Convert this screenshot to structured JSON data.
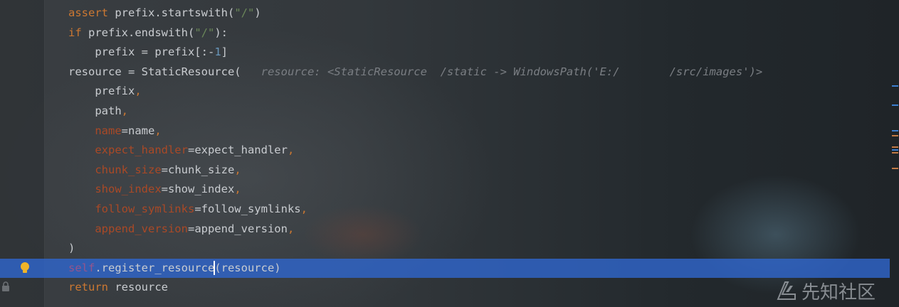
{
  "editor": {
    "lines": [
      [
        {
          "t": "assert ",
          "c": "kw"
        },
        {
          "t": "prefix.startswith(",
          "c": ""
        },
        {
          "t": "\"/\"",
          "c": "str"
        },
        {
          "t": ")",
          "c": ""
        }
      ],
      [
        {
          "t": "if ",
          "c": "kw"
        },
        {
          "t": "prefix.endswith(",
          "c": ""
        },
        {
          "t": "\"/\"",
          "c": "str"
        },
        {
          "t": "):",
          "c": ""
        }
      ],
      [
        {
          "t": "    prefix = prefix[:-",
          "c": ""
        },
        {
          "t": "1",
          "c": "num"
        },
        {
          "t": "]",
          "c": ""
        }
      ],
      [
        {
          "t": "resource = StaticResource(",
          "c": ""
        },
        {
          "t": "   resource: <StaticResource  /static -> WindowsPath('E:/",
          "c": "hint"
        },
        {
          "t": "",
          "c": "mask"
        },
        {
          "t": "/src/images')>",
          "c": "hint"
        }
      ],
      [
        {
          "t": "    prefix",
          "c": ""
        },
        {
          "t": ",",
          "c": "kw"
        }
      ],
      [
        {
          "t": "    path",
          "c": ""
        },
        {
          "t": ",",
          "c": "kw"
        }
      ],
      [
        {
          "t": "    ",
          "c": ""
        },
        {
          "t": "name",
          "c": "param"
        },
        {
          "t": "=name",
          "c": ""
        },
        {
          "t": ",",
          "c": "kw"
        }
      ],
      [
        {
          "t": "    ",
          "c": ""
        },
        {
          "t": "expect_handler",
          "c": "param"
        },
        {
          "t": "=expect_handler",
          "c": ""
        },
        {
          "t": ",",
          "c": "kw"
        }
      ],
      [
        {
          "t": "    ",
          "c": ""
        },
        {
          "t": "chunk_size",
          "c": "param"
        },
        {
          "t": "=chunk_size",
          "c": ""
        },
        {
          "t": ",",
          "c": "kw"
        }
      ],
      [
        {
          "t": "    ",
          "c": ""
        },
        {
          "t": "show_index",
          "c": "param"
        },
        {
          "t": "=show_index",
          "c": ""
        },
        {
          "t": ",",
          "c": "kw"
        }
      ],
      [
        {
          "t": "    ",
          "c": ""
        },
        {
          "t": "follow_symlinks",
          "c": "param"
        },
        {
          "t": "=follow_symlinks",
          "c": ""
        },
        {
          "t": ",",
          "c": "kw"
        }
      ],
      [
        {
          "t": "    ",
          "c": ""
        },
        {
          "t": "append_version",
          "c": "param"
        },
        {
          "t": "=append_version",
          "c": ""
        },
        {
          "t": ",",
          "c": "kw"
        }
      ],
      [
        {
          "t": ")",
          "c": ""
        }
      ],
      [
        {
          "t": "self",
          "c": "self"
        },
        {
          "t": ".register_resource",
          "c": ""
        },
        {
          "t": "",
          "c": "caret"
        },
        {
          "t": "(resource)",
          "c": ""
        }
      ],
      [
        {
          "t": "return ",
          "c": "kw"
        },
        {
          "t": "resource",
          "c": ""
        }
      ]
    ],
    "highlighted_line": 13
  },
  "watermark": {
    "text": "先知社区"
  },
  "scrollbar_marks": [
    {
      "color": "#3d7fd0",
      "row": 120
    },
    {
      "color": "#3d7fd0",
      "row": 147
    },
    {
      "color": "#3d7fd0",
      "row": 183
    },
    {
      "color": "#c27a45",
      "row": 190
    },
    {
      "color": "#c27a45",
      "row": 206
    },
    {
      "color": "#3d7fd0",
      "row": 210
    },
    {
      "color": "#c27a45",
      "row": 214
    },
    {
      "color": "#c27a45",
      "row": 236
    }
  ],
  "icons": {
    "gutter": "lightbulb-icon",
    "gutter_bottom": "lock-icon",
    "watermark": "xianzhi-logo-icon"
  }
}
